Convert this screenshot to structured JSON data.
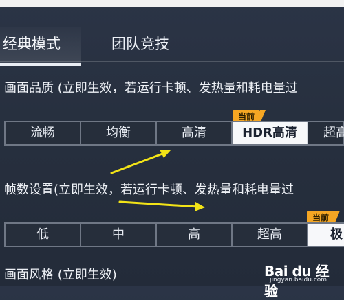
{
  "tabs": [
    {
      "label": "经典模式",
      "active": true
    },
    {
      "label": "团队竞技",
      "active": false
    }
  ],
  "quality": {
    "title": "画面品质 (立即生效，若运行卡顿、发热量和耗电量过",
    "options": [
      "流畅",
      "均衡",
      "高清",
      "HDR高清",
      "超高"
    ],
    "selected": "HDR高清",
    "badge": "当前"
  },
  "fps": {
    "title": "帧数设置(立即生效，若运行卡顿、发热量和耗电量过",
    "options": [
      "低",
      "中",
      "高",
      "超高",
      "极"
    ],
    "selected": "极",
    "badge": "当前"
  },
  "style": {
    "title": "画面风格 (立即生效)"
  },
  "watermark": {
    "logo": "Bai du 经验",
    "url": "jingyan.baidu.com"
  },
  "colors": {
    "background": "#27303f",
    "accent_badge": "#f5a623",
    "arrow": "#f3e417",
    "selected_bg": "#f7f8fa"
  }
}
